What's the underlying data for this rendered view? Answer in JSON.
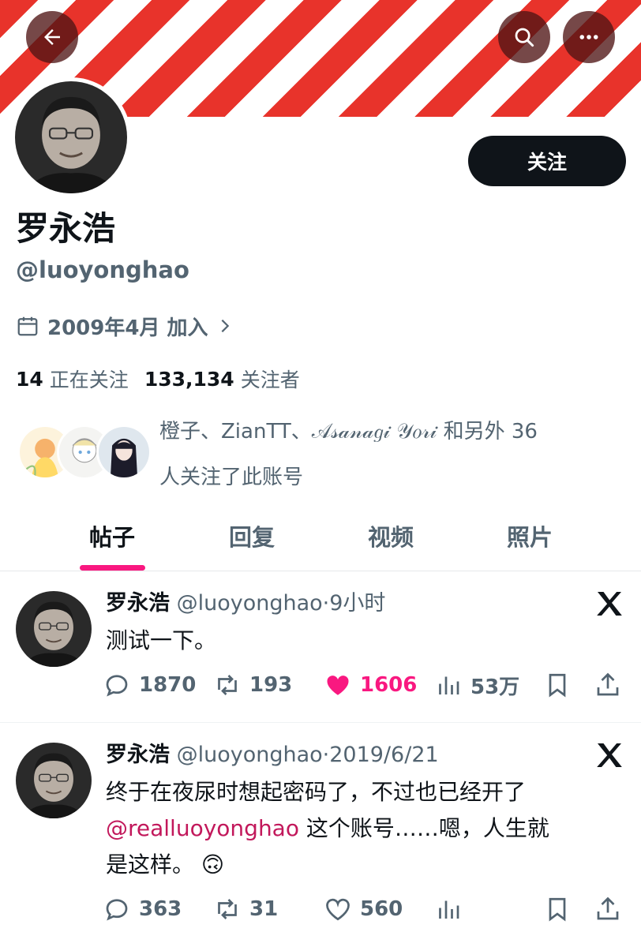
{
  "header": {
    "banner_colors": [
      "#e8332b",
      "#ffffff"
    ],
    "back_icon": "arrow-left-icon",
    "search_icon": "search-icon",
    "more_icon": "more-horizontal-icon"
  },
  "profile": {
    "follow_label": "关注",
    "display_name": "罗永浩",
    "handle": "@luoyonghao",
    "joined": "2009年4月 加入",
    "following_count": "14",
    "following_label": "正在关注",
    "followers_count": "133,134",
    "followers_label": "关注者",
    "followed_by_line1": "橙子、ZianTT、𝒜𝓈𝒶𝓃𝒶𝑔𝒾 𝒴𝑜𝓇𝒾 和另外 36",
    "followed_by_line2": "人关注了此账号"
  },
  "tabs": [
    {
      "label": "帖子",
      "active": true
    },
    {
      "label": "回复",
      "active": false
    },
    {
      "label": "视频",
      "active": false
    },
    {
      "label": "照片",
      "active": false
    }
  ],
  "accent_color": "#f91880",
  "posts": [
    {
      "name": "罗永浩",
      "handle_time": "@luoyonghao·9小时",
      "text": "测试一下。",
      "replies": "1870",
      "retweets": "193",
      "likes": "1606",
      "liked": true,
      "views": "53万"
    },
    {
      "name": "罗永浩",
      "handle_time": "@luoyonghao·2019/6/21",
      "text_line1": "终于在夜尿时想起密码了，不过也已经开了",
      "mention": "@realluoyonghao",
      "text_after_mention": " 这个账号……嗯，人生就",
      "text_line3": "是这样。",
      "emoji": "🙃",
      "replies": "363",
      "retweets": "31",
      "likes": "560",
      "liked": false,
      "views": ""
    }
  ]
}
